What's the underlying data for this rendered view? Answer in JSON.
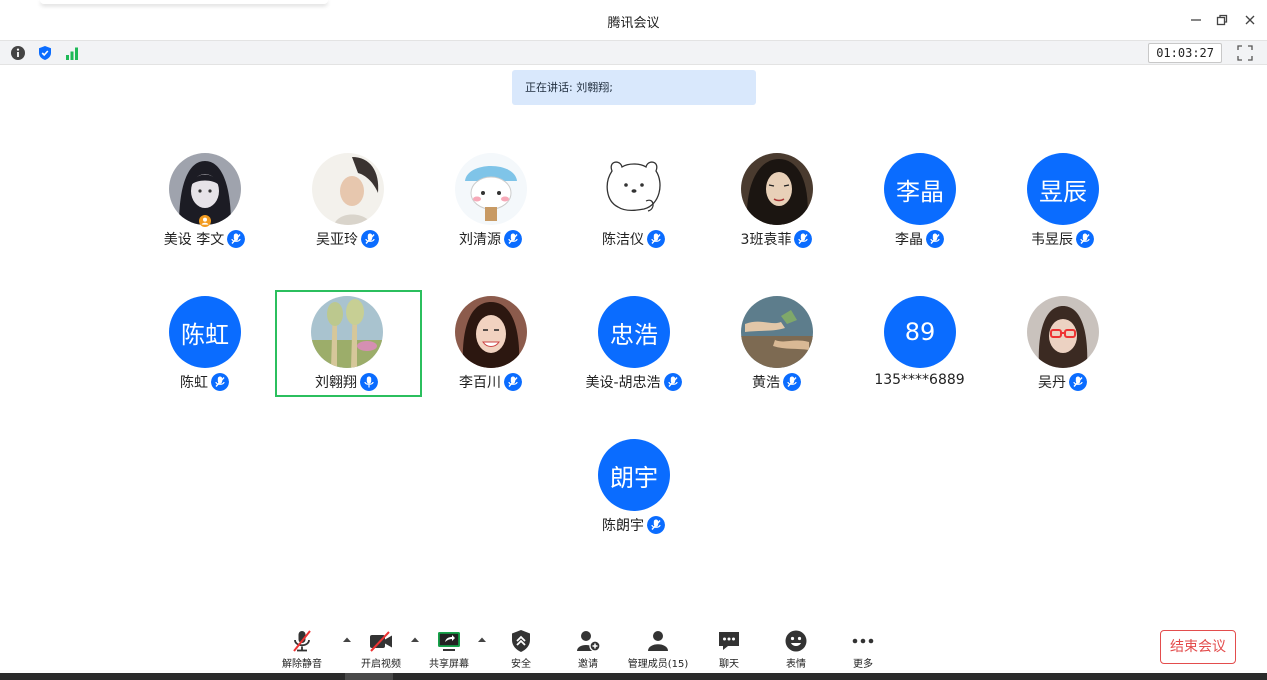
{
  "window": {
    "title": "腾讯会议",
    "minimize_label": "—",
    "restore_label": "⧉",
    "close_label": "✕"
  },
  "infobar": {
    "timer": "01:03:27",
    "icons": [
      "info-icon",
      "shield-icon",
      "signal-icon",
      "fullscreen-icon"
    ]
  },
  "speaking": {
    "text": "正在讲话: 刘翱翔;"
  },
  "participants": [
    {
      "name": "美设 李文",
      "avatar": "photo-dark-girl",
      "host": true
    },
    {
      "name": "吴亚玲",
      "avatar": "photo-woman-profile"
    },
    {
      "name": "刘清源",
      "avatar": "photo-cartoon-bear"
    },
    {
      "name": "陈洁仪",
      "avatar": "photo-sketch-bear"
    },
    {
      "name": "3班袁菲",
      "avatar": "photo-painted-woman"
    },
    {
      "name": "李晶",
      "avatar_text": "李晶"
    },
    {
      "name": "韦昱辰",
      "avatar_text": "昱辰"
    },
    {
      "name": "陈虹",
      "avatar_text": "陈虹"
    },
    {
      "name": "刘翱翔",
      "avatar": "photo-landscape-painting",
      "speaking": true
    },
    {
      "name": "李百川",
      "avatar": "photo-smiling-girl"
    },
    {
      "name": "美设-胡忠浩",
      "avatar_text": "忠浩"
    },
    {
      "name": "黄浩",
      "avatar": "photo-hands-painting"
    },
    {
      "name": "135****6889",
      "avatar_text": "89"
    },
    {
      "name": "吴丹",
      "avatar": "photo-girl-glasses"
    },
    {
      "name": "陈朗宇",
      "avatar_text": "朗宇"
    }
  ],
  "toolbar": {
    "items": [
      {
        "label": "解除静音",
        "icon": "mic-muted-icon"
      },
      {
        "label": "开启视频",
        "icon": "video-off-icon"
      },
      {
        "label": "共享屏幕",
        "icon": "share-screen-icon"
      },
      {
        "label": "安全",
        "icon": "security-icon"
      },
      {
        "label": "邀请",
        "icon": "invite-icon"
      },
      {
        "label": "管理成员(15)",
        "icon": "members-icon"
      },
      {
        "label": "聊天",
        "icon": "chat-icon"
      },
      {
        "label": "表情",
        "icon": "emoji-icon"
      },
      {
        "label": "更多",
        "icon": "more-icon"
      }
    ],
    "end_meeting": "结束会议"
  },
  "colors": {
    "accent": "#0a6cff",
    "speaking_border": "#2bbf5e",
    "end_meeting": "#e34d4d",
    "speaking_banner": "#d9e8fc"
  }
}
